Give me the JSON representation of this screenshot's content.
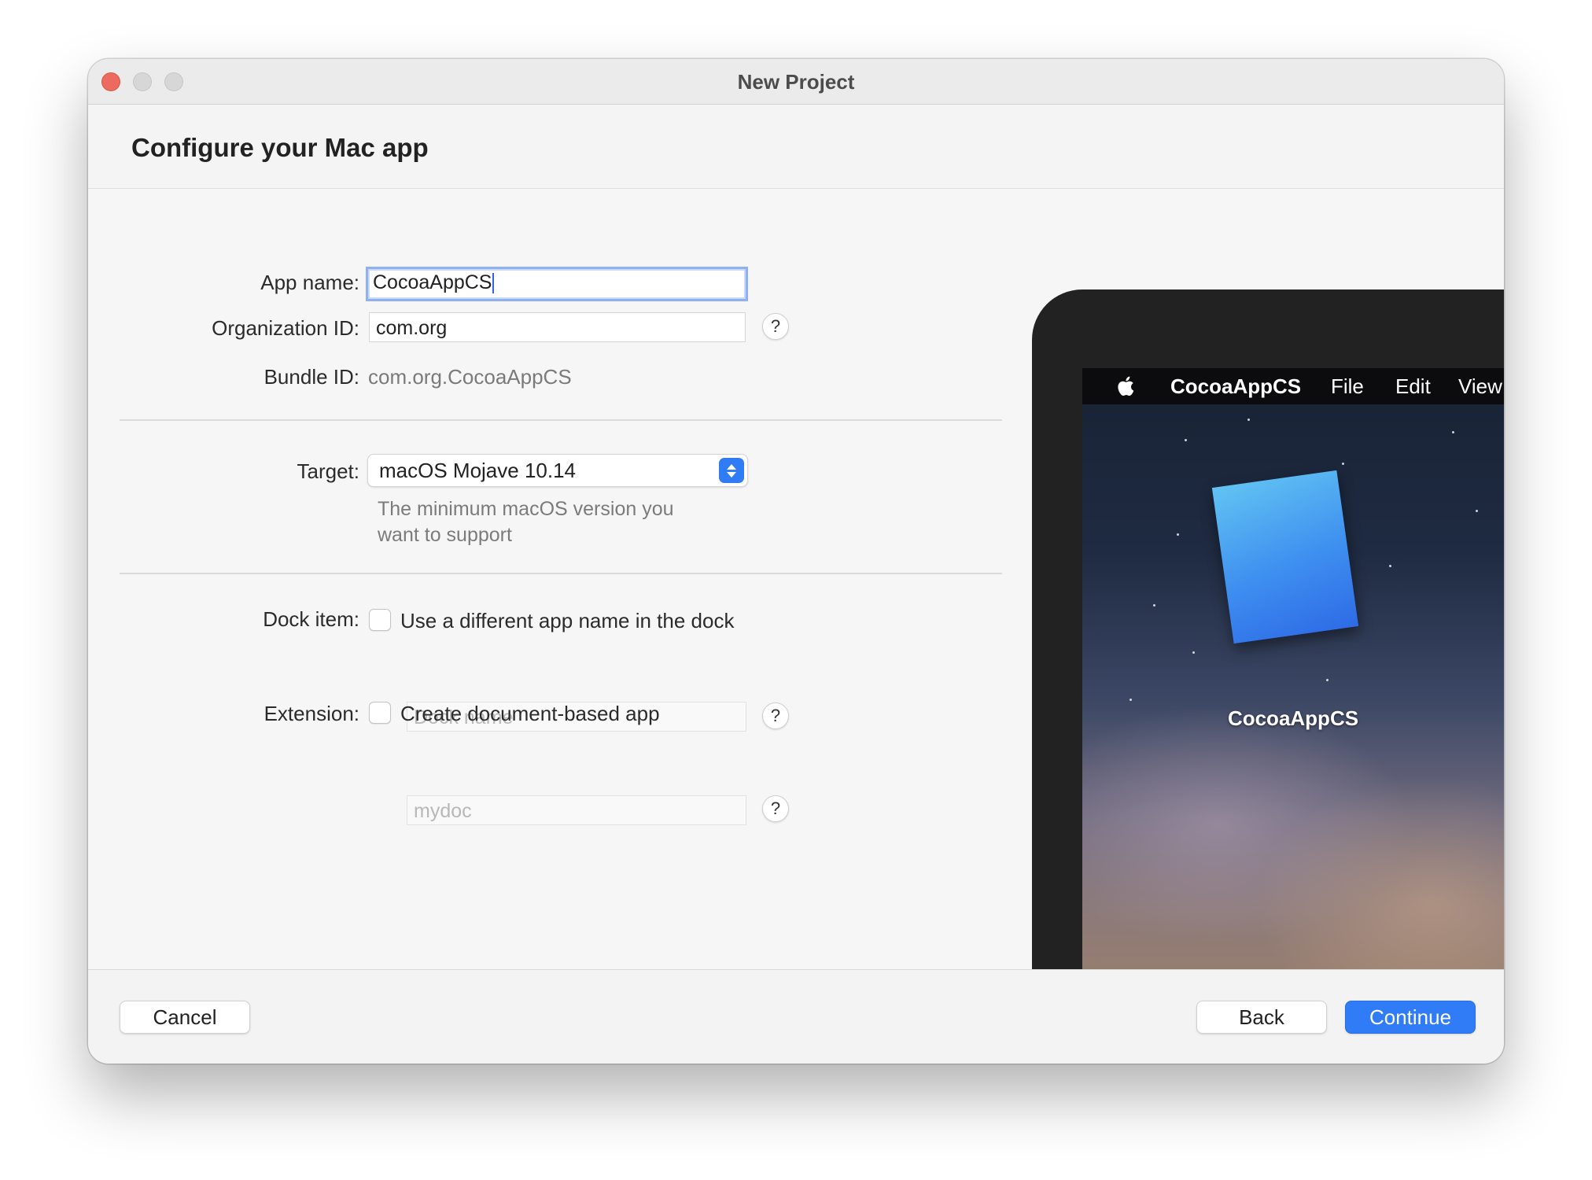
{
  "window": {
    "title": "New Project"
  },
  "header": {
    "title": "Configure your Mac app"
  },
  "form": {
    "app_name": {
      "label": "App name:",
      "value": "CocoaAppCS"
    },
    "org_id": {
      "label": "Organization ID:",
      "value": "com.org",
      "help": "?"
    },
    "bundle_id": {
      "label": "Bundle ID:",
      "value": "com.org.CocoaAppCS"
    },
    "target": {
      "label": "Target:",
      "selected": "macOS Mojave 10.14",
      "hint": "The minimum macOS version you want to support"
    },
    "dock_item": {
      "label": "Dock item:",
      "checkbox_label": "Use a different app name in the dock",
      "checked": false,
      "placeholder": "Dock name",
      "help": "?"
    },
    "extension": {
      "label": "Extension:",
      "checkbox_label": "Create document-based app",
      "checked": false,
      "placeholder": "mydoc",
      "help": "?"
    }
  },
  "preview": {
    "menubar": {
      "app": "CocoaAppCS",
      "items": [
        "File",
        "Edit",
        "View"
      ]
    },
    "icon_name": "CocoaAppCS"
  },
  "footer": {
    "cancel": "Cancel",
    "back": "Back",
    "continue": "Continue"
  },
  "colors": {
    "accent": "#2f7cf6",
    "close": "#ed6a5e",
    "focus_ring": "#8fb0f5"
  }
}
